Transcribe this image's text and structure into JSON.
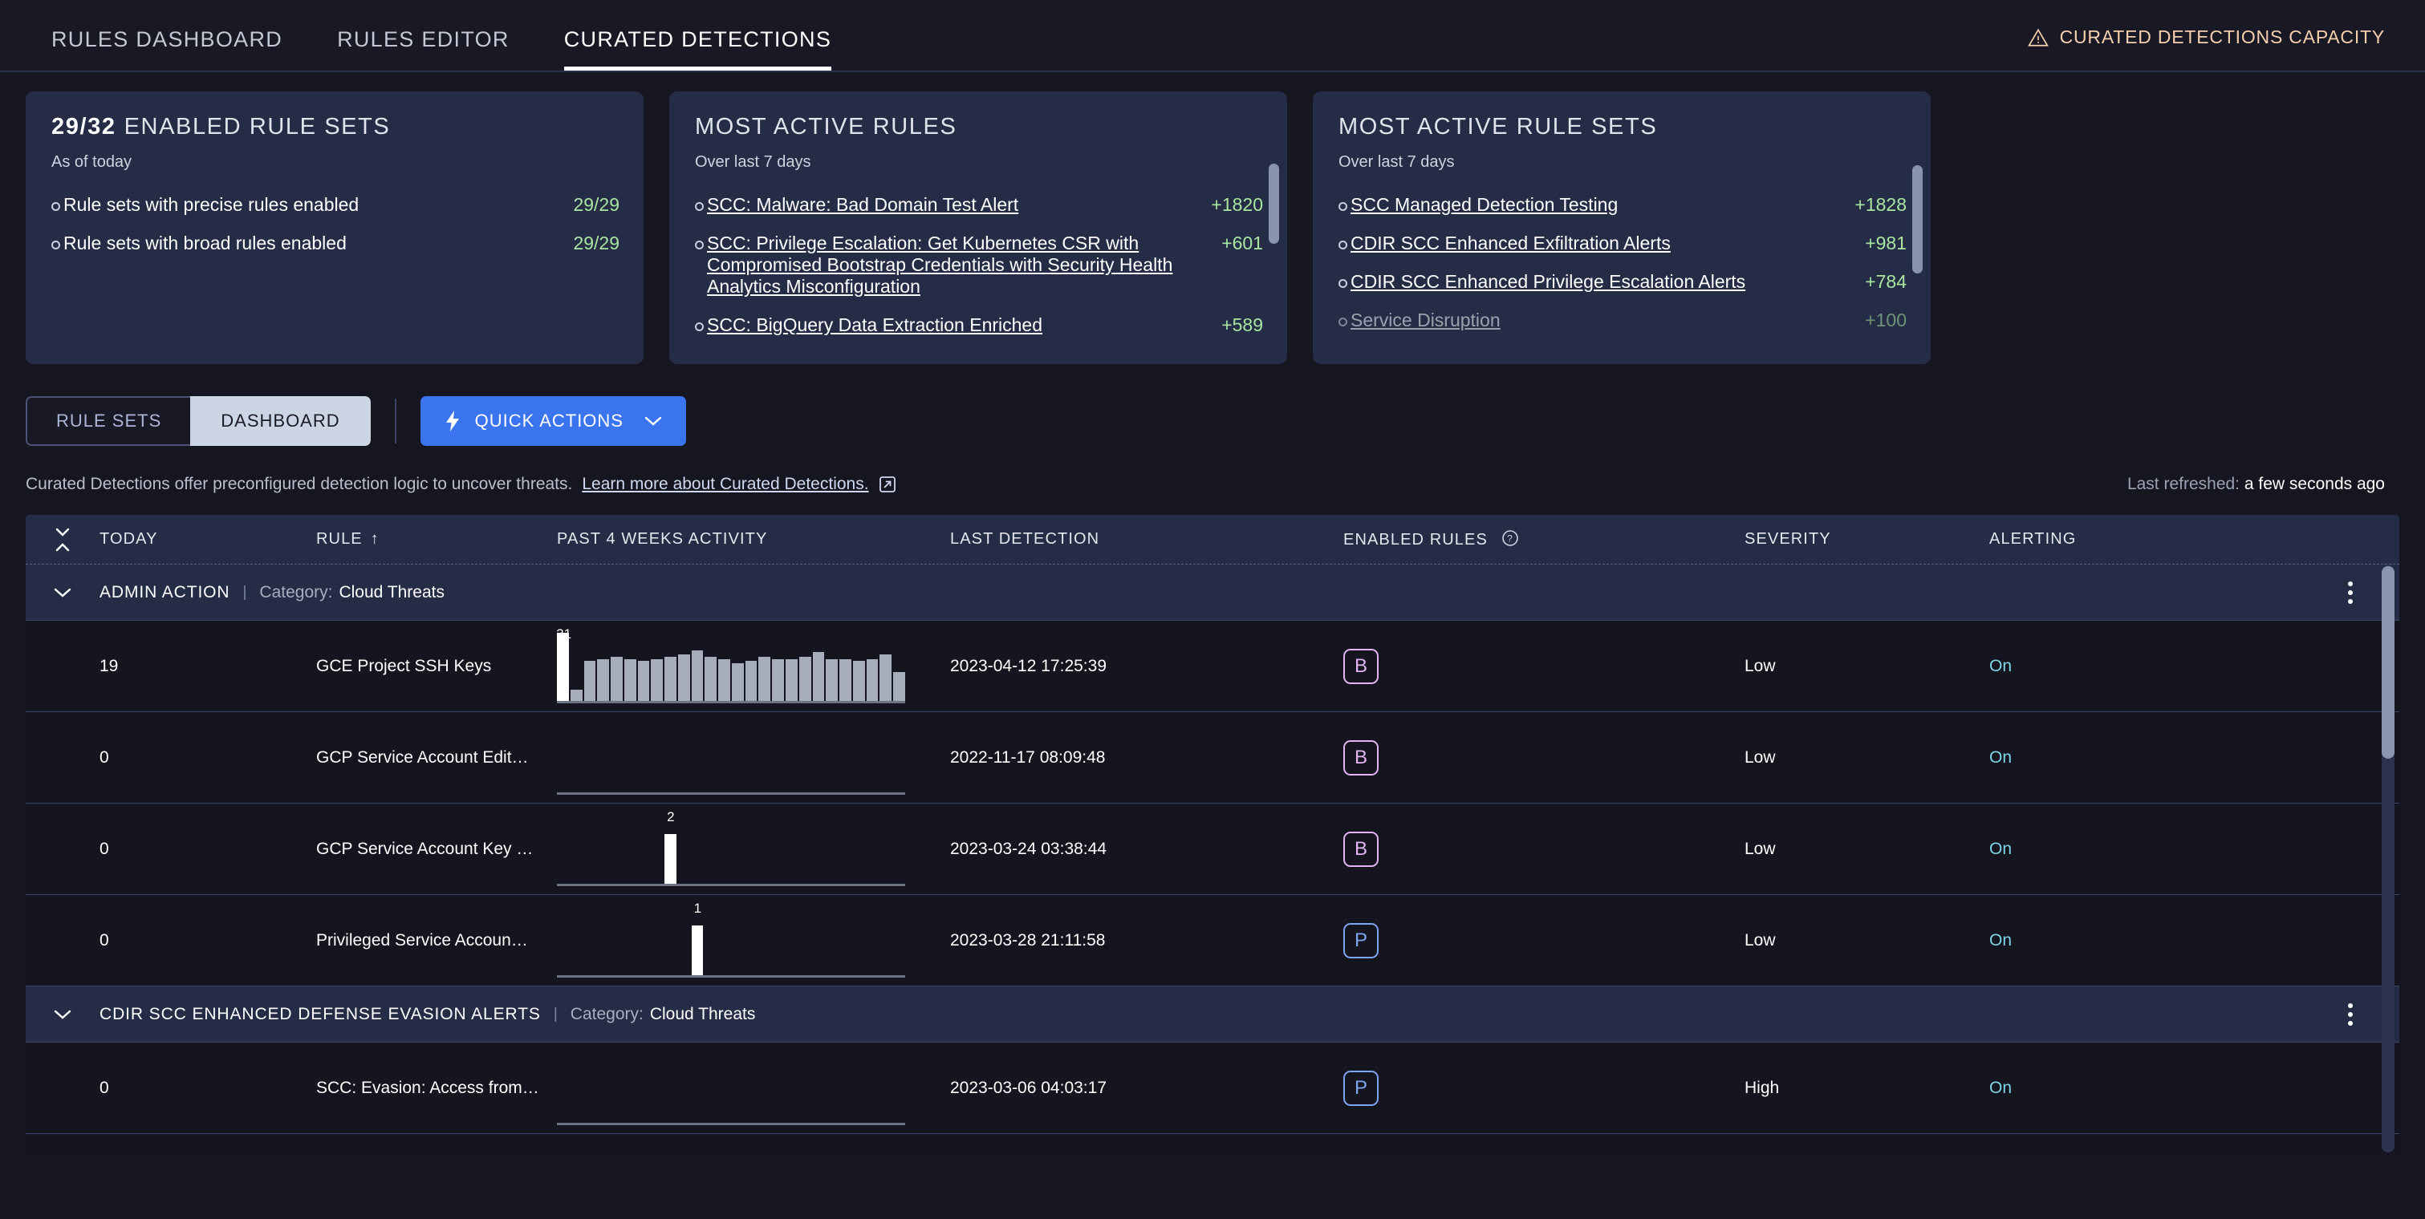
{
  "topnav": {
    "tabs": [
      {
        "label": "RULES DASHBOARD",
        "active": false
      },
      {
        "label": "RULES EDITOR",
        "active": false
      },
      {
        "label": "CURATED DETECTIONS",
        "active": true
      }
    ],
    "capacity_label": "CURATED DETECTIONS CAPACITY",
    "capacity_color": "#f6cfad"
  },
  "cards": {
    "enabled_rule_sets": {
      "stat": "29/32",
      "title": "ENABLED RULE SETS",
      "subtitle": "As of today",
      "items": [
        {
          "label": "Rule sets with precise rules enabled",
          "value": "29/29"
        },
        {
          "label": "Rule sets with broad rules enabled",
          "value": "29/29"
        }
      ]
    },
    "most_active_rules": {
      "title": "MOST ACTIVE RULES",
      "subtitle": "Over last 7 days",
      "items": [
        {
          "label": "SCC: Malware: Bad Domain Test Alert",
          "value": "+1820"
        },
        {
          "label": "SCC: Privilege Escalation: Get Kubernetes CSR with Compromised Bootstrap Credentials with Security Health Analytics Misconfiguration",
          "value": "+601"
        },
        {
          "label": "SCC: BigQuery Data Extraction Enriched",
          "value": "+589"
        }
      ]
    },
    "most_active_rule_sets": {
      "title": "MOST ACTIVE RULE SETS",
      "subtitle": "Over last 7 days",
      "items": [
        {
          "label": "SCC Managed Detection Testing",
          "value": "+1828"
        },
        {
          "label": "CDIR SCC Enhanced Exfiltration Alerts",
          "value": "+981"
        },
        {
          "label": "CDIR SCC Enhanced Privilege Escalation Alerts",
          "value": "+784"
        },
        {
          "label": "Service Disruption",
          "value": "+100"
        }
      ]
    },
    "value_color": "#a8e6a1"
  },
  "toolbar": {
    "rule_sets_label": "RULE SETS",
    "dashboard_label": "DASHBOARD",
    "quick_actions_label": "QUICK ACTIONS",
    "accent_color": "#3b74ef"
  },
  "infoline": {
    "text": "Curated Detections offer preconfigured detection logic to uncover threats.",
    "link": "Learn more about Curated Detections.",
    "refresh_label": "Last refreshed:",
    "refresh_value": "a few seconds ago"
  },
  "table": {
    "headers": {
      "today": "TODAY",
      "rule": "RULE",
      "sort_arrow": "↑",
      "activity": "PAST 4 WEEKS ACTIVITY",
      "last_detection": "LAST DETECTION",
      "enabled_rules": "ENABLED RULES",
      "severity": "SEVERITY",
      "alerting": "ALERTING"
    },
    "category_label": "Category:",
    "groups": [
      {
        "name": "ADMIN ACTION",
        "category": "Cloud Threats",
        "rows": [
          {
            "today": "19",
            "rule": "GCE Project SSH Keys",
            "last_detection": "2023-04-12 17:25:39",
            "enabled_badge": "B",
            "badge_type": "b",
            "severity": "Low",
            "alerting": "On",
            "spark_peak_label": "31",
            "spark_peak_index": 0,
            "spark_values": [
              31,
              5,
              18,
              19,
              20,
              19,
              18,
              19,
              20,
              21,
              23,
              20,
              19,
              17,
              18,
              20,
              19,
              19,
              20,
              22,
              19,
              19,
              18,
              19,
              21,
              13
            ]
          },
          {
            "today": "0",
            "rule": "GCP Service Account Edit…",
            "last_detection": "2022-11-17 08:09:48",
            "enabled_badge": "B",
            "badge_type": "b",
            "severity": "Low",
            "alerting": "On",
            "spark_peak_label": "",
            "spark_peak_index": -1,
            "spark_values": [
              0,
              0,
              0,
              0,
              0,
              0,
              0,
              0,
              0,
              0,
              0,
              0,
              0,
              0,
              0,
              0,
              0,
              0,
              0,
              0,
              0,
              0,
              0,
              0,
              0,
              0
            ]
          },
          {
            "today": "0",
            "rule": "GCP Service Account Key …",
            "last_detection": "2023-03-24 03:38:44",
            "enabled_badge": "B",
            "badge_type": "b",
            "severity": "Low",
            "alerting": "On",
            "spark_peak_label": "2",
            "spark_peak_index": 8,
            "spark_values": [
              0,
              0,
              0,
              0,
              0,
              0,
              0,
              0,
              2,
              0,
              0,
              0,
              0,
              0,
              0,
              0,
              0,
              0,
              0,
              0,
              0,
              0,
              0,
              0,
              0,
              0
            ]
          },
          {
            "today": "0",
            "rule": "Privileged Service Accoun…",
            "last_detection": "2023-03-28 21:11:58",
            "enabled_badge": "P",
            "badge_type": "p",
            "severity": "Low",
            "alerting": "On",
            "spark_peak_label": "1",
            "spark_peak_index": 10,
            "spark_values": [
              0,
              0,
              0,
              0,
              0,
              0,
              0,
              0,
              0,
              0,
              1,
              0,
              0,
              0,
              0,
              0,
              0,
              0,
              0,
              0,
              0,
              0,
              0,
              0,
              0,
              0
            ]
          }
        ]
      },
      {
        "name": "CDIR SCC ENHANCED DEFENSE EVASION ALERTS",
        "category": "Cloud Threats",
        "rows": [
          {
            "today": "0",
            "rule": "SCC: Evasion: Access from…",
            "last_detection": "2023-03-06 04:03:17",
            "enabled_badge": "P",
            "badge_type": "p",
            "severity": "High",
            "alerting": "On",
            "spark_peak_label": "",
            "spark_peak_index": -1,
            "spark_values": [
              0,
              0,
              0,
              0,
              0,
              0,
              0,
              0,
              0,
              0,
              0,
              0,
              0,
              0,
              0,
              0,
              0,
              0,
              0,
              0,
              0,
              0,
              0,
              0,
              0,
              0
            ]
          }
        ]
      }
    ],
    "badge_color_b": "#e2b4f5",
    "badge_color_p": "#7ea6f0",
    "alerting_color": "#7fd4e8"
  }
}
